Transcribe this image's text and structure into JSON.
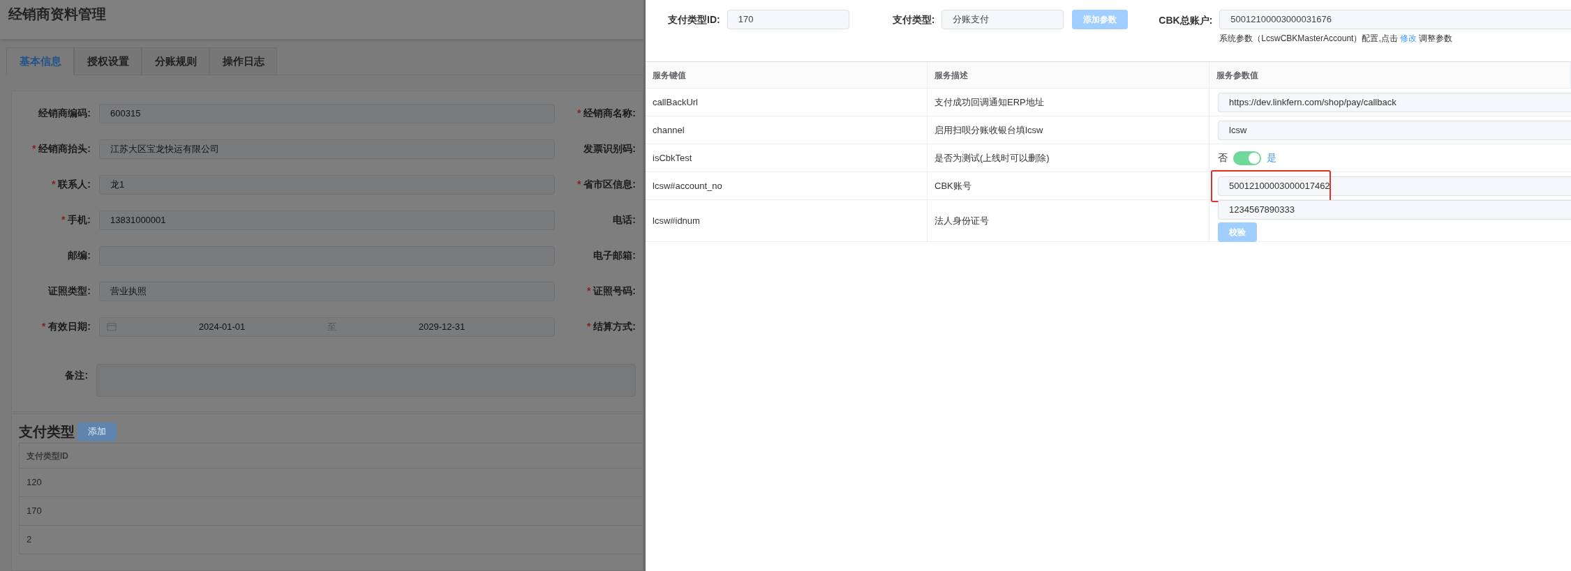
{
  "page": {
    "title": "经销商资料管理"
  },
  "required_mark": "*",
  "tabs": [
    {
      "label": "基本信息",
      "selected": true
    },
    {
      "label": "授权设置",
      "selected": false
    },
    {
      "label": "分账规则",
      "selected": false
    },
    {
      "label": "操作日志",
      "selected": false
    }
  ],
  "form_rows": [
    {
      "left": {
        "label": "经销商编码:",
        "required": false,
        "kind": "text",
        "value": "600315"
      },
      "right": {
        "label": "经销商名称:",
        "required": true
      }
    },
    {
      "left": {
        "label": "经销商抬头:",
        "required": true,
        "kind": "text",
        "value": "江苏大区宝龙快运有限公司"
      },
      "right": {
        "label": "发票识别码:",
        "required": false
      }
    },
    {
      "left": {
        "label": "联系人:",
        "required": true,
        "kind": "text",
        "value": "龙1"
      },
      "right": {
        "label": "省市区信息:",
        "required": true
      }
    },
    {
      "left": {
        "label": "手机:",
        "required": true,
        "kind": "text",
        "value": "13831000001"
      },
      "right": {
        "label": "电话:",
        "required": false
      }
    },
    {
      "left": {
        "label": "邮编:",
        "required": false,
        "kind": "text"
      },
      "right": {
        "label": "电子邮箱:",
        "required": false
      }
    },
    {
      "left": {
        "label": "证照类型:",
        "required": false,
        "kind": "text",
        "value": "营业执照"
      },
      "right": {
        "label": "证照号码:",
        "required": true
      }
    },
    {
      "left": {
        "label": "有效日期:",
        "required": true,
        "kind": "date_range",
        "start": "2024-01-01",
        "separator": "至",
        "end": "2029-12-31"
      },
      "right": {
        "label": "结算方式:",
        "required": true
      }
    },
    {
      "left": {
        "label": "备注:",
        "required": false,
        "kind": "textarea"
      }
    }
  ],
  "payment_types": {
    "title": "支付类型",
    "add_button": "添加",
    "columns": [
      "支付类型ID"
    ],
    "rows": [
      "120",
      "170",
      "2"
    ]
  },
  "drawer": {
    "fields": [
      {
        "label": "支付类型ID:",
        "value": "170"
      },
      {
        "label": "支付类型:",
        "value": "分账支付"
      }
    ],
    "add_param_button": "添加参数",
    "master_account": {
      "label": "CBK总账户:",
      "value": "50012100003000031676",
      "note": "系统参数（LcswCBKMasterAccount）配置,点击",
      "link": "修改",
      "note_tail": "调整参数"
    },
    "columns": [
      "服务键值",
      "服务描述",
      "服务参数值"
    ],
    "rows": [
      {
        "key": "callBackUrl",
        "description": "支付成功回调通知ERP地址",
        "kind": "input",
        "value": "https://dev.linkfern.com/shop/pay/callback",
        "highlighted": false
      },
      {
        "key": "channel",
        "description": "启用扫呗分账收银台填lcsw",
        "kind": "input",
        "value": "lcsw",
        "highlighted": false
      },
      {
        "key": "isCbkTest",
        "description": "是否为测试(上线时可以删除)",
        "kind": "switch",
        "off_label": "否",
        "on_label": "是",
        "on": true
      },
      {
        "key": "lcsw#account_no",
        "description": "CBK账号",
        "kind": "input",
        "value": "50012100003000017462",
        "highlighted": true
      },
      {
        "key": "lcsw#idnum",
        "description": "法人身份证号",
        "kind": "input_verify",
        "value": "1234567890333",
        "button": "校验",
        "highlighted": false
      }
    ]
  }
}
